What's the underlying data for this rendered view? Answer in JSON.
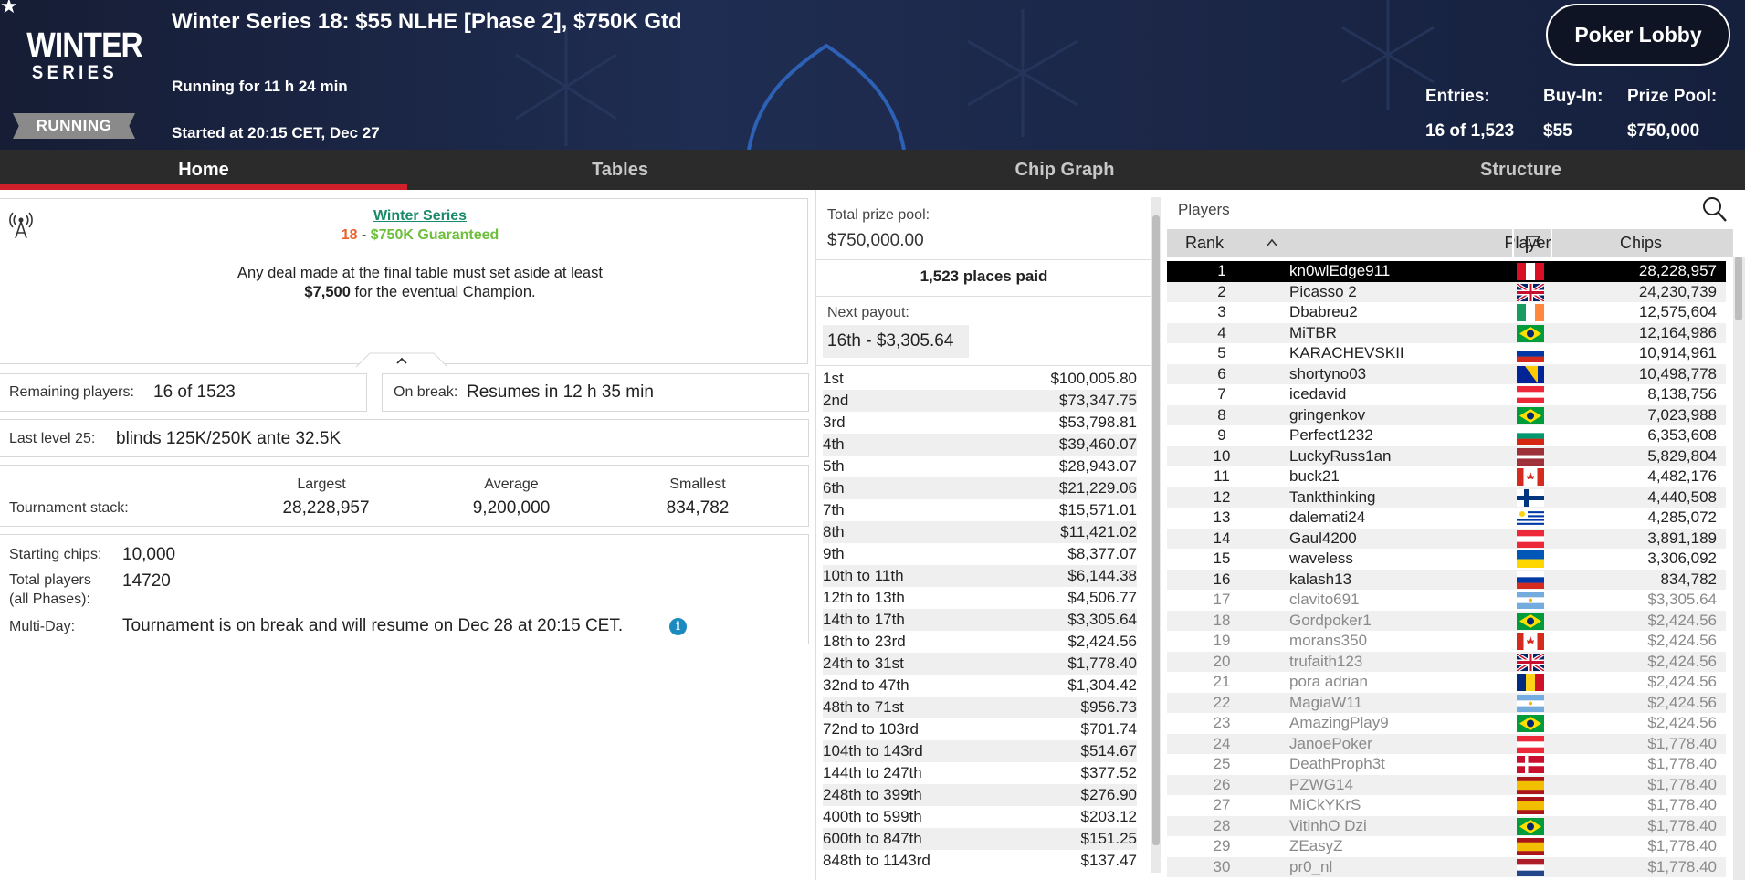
{
  "header": {
    "logo_line1": "WINTER",
    "logo_line2": "SERIES",
    "status": "RUNNING",
    "title": "Winter Series 18: $55 NLHE [Phase 2], $750K Gtd",
    "running_for": "Running for 11 h 24 min",
    "started_at": "Started at 20:15 CET, Dec 27",
    "lobby_button": "Poker Lobby",
    "entries_label": "Entries:",
    "entries_value": "16 of 1,523",
    "buyin_label": "Buy-In:",
    "buyin_value": "$55",
    "prizepool_label": "Prize Pool:",
    "prizepool_value": "$750,000"
  },
  "tabs": [
    "Home",
    "Tables",
    "Chip Graph",
    "Structure"
  ],
  "info": {
    "series_link": "Winter Series",
    "event_num": "18",
    "event_sep": " - ",
    "event_name": "$750K Guaranteed",
    "deal_line1": "Any deal made at the final table must set aside at least",
    "deal_amount": "$7,500",
    "deal_line2": " for the eventual Champion.",
    "remaining_label": "Remaining players:",
    "remaining_value": "16 of 1523",
    "break_label": "On break:",
    "break_value": "Resumes in 12 h 35 min",
    "level_label": "Last level 25:",
    "level_value": "blinds 125K/250K ante 32.5K",
    "stack_label": "Tournament stack:",
    "largest_label": "Largest",
    "largest_value": "28,228,957",
    "average_label": "Average",
    "average_value": "9,200,000",
    "smallest_label": "Smallest",
    "smallest_value": "834,782",
    "start_chips_label": "Starting chips:",
    "start_chips_value": "10,000",
    "total_players_label": "Total players",
    "total_players_label2": "(all Phases):",
    "total_players_value": "14720",
    "multiday_label": "Multi-Day:",
    "multiday_value": "Tournament is on break and will resume on Dec 28 at 20:15 CET."
  },
  "prizes": {
    "total_label": "Total prize pool:",
    "total_value": "$750,000.00",
    "places_paid": "1,523 places paid",
    "next_label": "Next payout:",
    "next_value": "16th - $3,305.64",
    "rows": [
      {
        "place": "1st",
        "amount": "$100,005.80"
      },
      {
        "place": "2nd",
        "amount": "$73,347.75"
      },
      {
        "place": "3rd",
        "amount": "$53,798.81"
      },
      {
        "place": "4th",
        "amount": "$39,460.07"
      },
      {
        "place": "5th",
        "amount": "$28,943.07"
      },
      {
        "place": "6th",
        "amount": "$21,229.06"
      },
      {
        "place": "7th",
        "amount": "$15,571.01"
      },
      {
        "place": "8th",
        "amount": "$11,421.02"
      },
      {
        "place": "9th",
        "amount": "$8,377.07"
      },
      {
        "place": "10th to 11th",
        "amount": "$6,144.38"
      },
      {
        "place": "12th to 13th",
        "amount": "$4,506.77"
      },
      {
        "place": "14th to 17th",
        "amount": "$3,305.64"
      },
      {
        "place": "18th to 23rd",
        "amount": "$2,424.56"
      },
      {
        "place": "24th to 31st",
        "amount": "$1,778.40"
      },
      {
        "place": "32nd to 47th",
        "amount": "$1,304.42"
      },
      {
        "place": "48th to 71st",
        "amount": "$956.73"
      },
      {
        "place": "72nd to 103rd",
        "amount": "$701.74"
      },
      {
        "place": "104th to 143rd",
        "amount": "$514.67"
      },
      {
        "place": "144th to 247th",
        "amount": "$377.52"
      },
      {
        "place": "248th to 399th",
        "amount": "$276.90"
      },
      {
        "place": "400th to 599th",
        "amount": "$203.12"
      },
      {
        "place": "600th to 847th",
        "amount": "$151.25"
      },
      {
        "place": "848th to 1143rd",
        "amount": "$137.47"
      }
    ]
  },
  "players": {
    "title": "Players",
    "col_rank": "Rank",
    "col_player": "Player",
    "col_chips": "Chips",
    "rows": [
      {
        "rank": "1",
        "name": "kn0wlEdge911",
        "chips": "28,228,957",
        "flag": "peru"
      },
      {
        "rank": "2",
        "name": "Picasso 2",
        "chips": "24,230,739",
        "flag": "uk"
      },
      {
        "rank": "3",
        "name": "Dbabreu2",
        "chips": "12,575,604",
        "flag": "ireland"
      },
      {
        "rank": "4",
        "name": "MiTBR",
        "chips": "12,164,986",
        "flag": "brazil"
      },
      {
        "rank": "5",
        "name": "KARACHEVSKII",
        "chips": "10,914,961",
        "flag": "russia"
      },
      {
        "rank": "6",
        "name": "shortyno03",
        "chips": "10,498,778",
        "flag": "bosnia"
      },
      {
        "rank": "7",
        "name": "icedavid",
        "chips": "8,138,756",
        "flag": "austria"
      },
      {
        "rank": "8",
        "name": "gringenkov",
        "chips": "7,023,988",
        "flag": "brazil"
      },
      {
        "rank": "9",
        "name": "Perfect1232",
        "chips": "6,353,608",
        "flag": "bulgaria"
      },
      {
        "rank": "10",
        "name": "LuckyRuss1an",
        "chips": "5,829,804",
        "flag": "latvia"
      },
      {
        "rank": "11",
        "name": "buck21",
        "chips": "4,482,176",
        "flag": "canada"
      },
      {
        "rank": "12",
        "name": "Tankthinking",
        "chips": "4,440,508",
        "flag": "finland"
      },
      {
        "rank": "13",
        "name": "dalemati24",
        "chips": "4,285,072",
        "flag": "uruguay"
      },
      {
        "rank": "14",
        "name": "Gaul4200",
        "chips": "3,891,189",
        "flag": "austria"
      },
      {
        "rank": "15",
        "name": "waveless",
        "chips": "3,306,092",
        "flag": "ukraine"
      },
      {
        "rank": "16",
        "name": "kalash13",
        "chips": "834,782",
        "flag": "russia"
      },
      {
        "rank": "17",
        "name": "clavito691",
        "chips": "$3,305.64",
        "flag": "argentina"
      },
      {
        "rank": "18",
        "name": "Gordpoker1",
        "chips": "$2,424.56",
        "flag": "brazil"
      },
      {
        "rank": "19",
        "name": "morans350",
        "chips": "$2,424.56",
        "flag": "canada"
      },
      {
        "rank": "20",
        "name": "trufaith123",
        "chips": "$2,424.56",
        "flag": "uk"
      },
      {
        "rank": "21",
        "name": "pora adrian",
        "chips": "$2,424.56",
        "flag": "romania"
      },
      {
        "rank": "22",
        "name": "MagiaW11",
        "chips": "$2,424.56",
        "flag": "argentina"
      },
      {
        "rank": "23",
        "name": "AmazingPlay9",
        "chips": "$2,424.56",
        "flag": "brazil"
      },
      {
        "rank": "24",
        "name": "JanoePoker",
        "chips": "$1,778.40",
        "flag": "austria"
      },
      {
        "rank": "25",
        "name": "DeathProph3t",
        "chips": "$1,778.40",
        "flag": "denmark"
      },
      {
        "rank": "26",
        "name": "PZWG14",
        "chips": "$1,778.40",
        "flag": "spain"
      },
      {
        "rank": "27",
        "name": "MiCkYKrS",
        "chips": "$1,778.40",
        "flag": "spain"
      },
      {
        "rank": "28",
        "name": "VitinhO Dzi",
        "chips": "$1,778.40",
        "flag": "brazil"
      },
      {
        "rank": "29",
        "name": "ZEasyZ",
        "chips": "$1,778.40",
        "flag": "spain"
      },
      {
        "rank": "30",
        "name": "pr0_nl",
        "chips": "$1,778.40",
        "flag": "netherlands"
      }
    ]
  },
  "colors": {
    "header_bg": "#1a2440",
    "nav_bg": "#2b2b2b",
    "tab_underline": "#d0202a",
    "link_green": "#1a8a6a",
    "event_num": "#e8622a",
    "guaranteed": "#6cbf3a",
    "info_icon": "#1a8ac0"
  },
  "icons": {
    "star": "star-icon",
    "broadcast": "broadcast-icon",
    "search": "search-icon",
    "flag_column": "flag-icon",
    "sort_up": "chevron-up-icon",
    "collapse": "chevron-up-icon",
    "info": "info-icon"
  }
}
